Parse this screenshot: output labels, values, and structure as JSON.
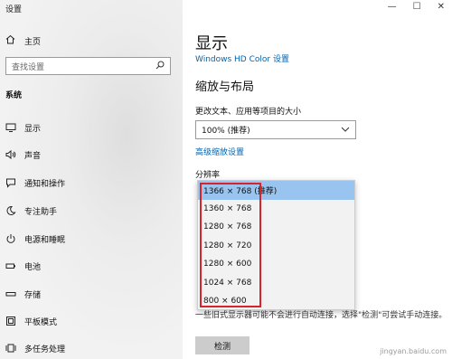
{
  "window": {
    "title": "设置",
    "controls": [
      "—",
      "☐",
      "✕"
    ]
  },
  "sidebar": {
    "home_label": "主页",
    "search_placeholder": "查找设置",
    "section_label": "系统",
    "items": [
      {
        "label": "显示",
        "icon": "monitor-icon"
      },
      {
        "label": "声音",
        "icon": "speaker-icon"
      },
      {
        "label": "通知和操作",
        "icon": "notification-icon"
      },
      {
        "label": "专注助手",
        "icon": "moon-icon"
      },
      {
        "label": "电源和睡眠",
        "icon": "power-icon"
      },
      {
        "label": "电池",
        "icon": "battery-icon"
      },
      {
        "label": "存储",
        "icon": "storage-icon"
      },
      {
        "label": "平板模式",
        "icon": "tablet-icon"
      },
      {
        "label": "多任务处理",
        "icon": "multitask-icon"
      }
    ]
  },
  "main": {
    "title": "显示",
    "hd_color_link": "Windows HD Color 设置",
    "scale_heading": "缩放与布局",
    "scale_description": "更改文本、应用等项目的大小",
    "scale_value": "100% (推荐)",
    "advanced_scaling_link": "高级缩放设置",
    "resolution_label": "分辨率",
    "resolution_options": [
      "1366 × 768 (推荐)",
      "1360 × 768",
      "1280 × 768",
      "1280 × 720",
      "1280 × 600",
      "1024 × 768",
      "800 × 600"
    ],
    "selected_resolution_index": 0,
    "obscured_text": "一些旧式显示器可能不会进行自动连接，选择\"检测\"可尝试手动连接。",
    "detect_button": "检测"
  },
  "watermark": "jingyan.baidu.com",
  "colors": {
    "accent_link": "#0063b1",
    "selected_option": "#99c4f0",
    "annotation_red": "#d9232a"
  }
}
